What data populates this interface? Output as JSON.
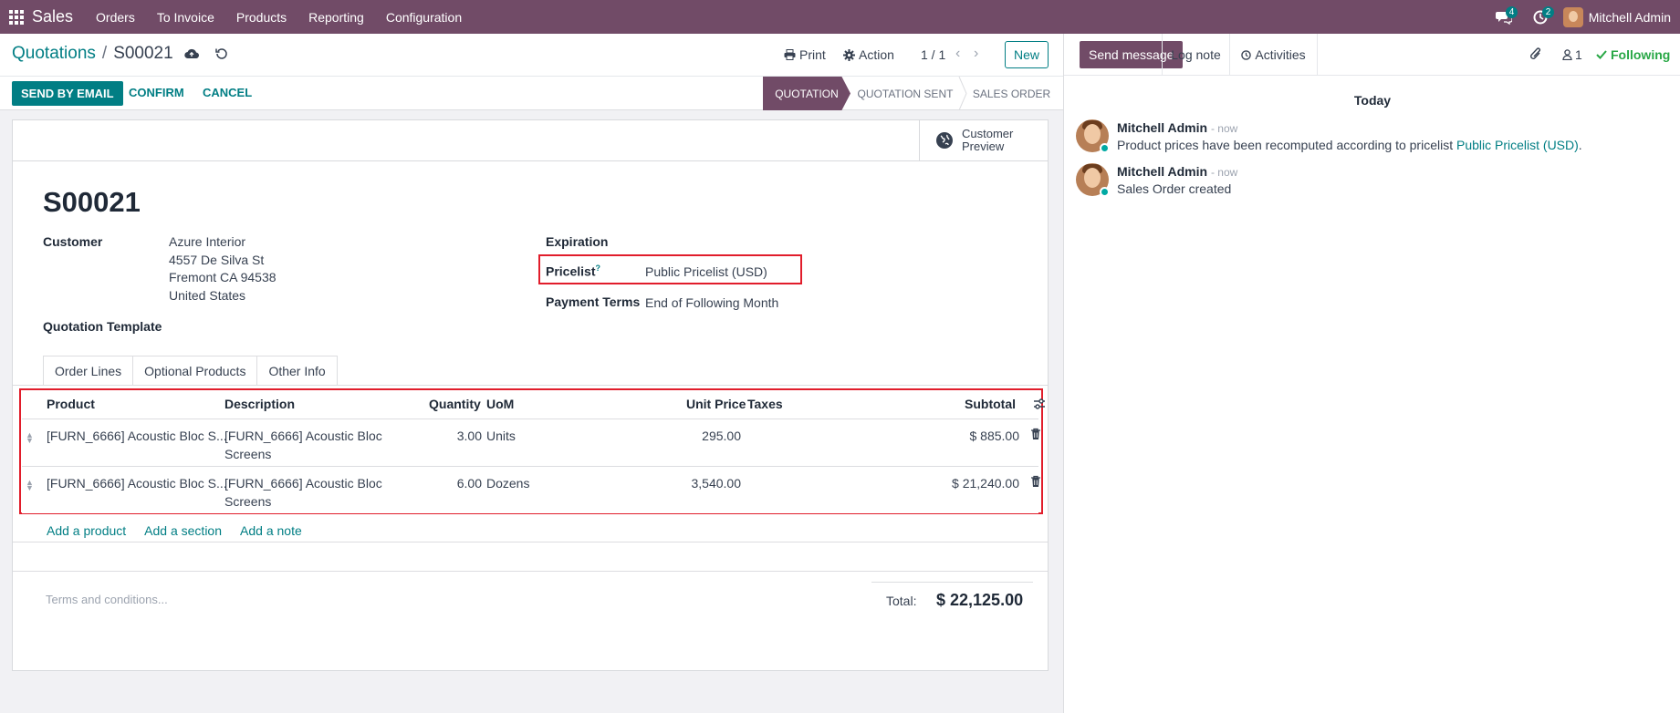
{
  "nav": {
    "app_name": "Sales",
    "menu": [
      "Orders",
      "To Invoice",
      "Products",
      "Reporting",
      "Configuration"
    ],
    "messages_badge": "4",
    "activities_badge": "2",
    "user_name": "Mitchell Admin"
  },
  "control": {
    "breadcrumb_parent": "Quotations",
    "breadcrumb_sep": "/",
    "record_name": "S00021",
    "print_label": "Print",
    "action_label": "Action",
    "pager": "1 / 1",
    "new_label": "New"
  },
  "statusbar": {
    "send_email_label": "SEND BY EMAIL",
    "confirm_label": "CONFIRM",
    "cancel_label": "CANCEL",
    "stages": [
      "QUOTATION",
      "QUOTATION SENT",
      "SALES ORDER"
    ],
    "active_stage": "QUOTATION"
  },
  "form": {
    "preview_line1": "Customer",
    "preview_line2": "Preview",
    "title": "S00021",
    "customer_label": "Customer",
    "customer_name": "Azure Interior",
    "customer_addr1": "4557 De Silva St",
    "customer_addr2": "Fremont CA 94538",
    "customer_addr3": "United States",
    "template_label": "Quotation Template",
    "expiration_label": "Expiration",
    "pricelist_label": "Pricelist",
    "pricelist_help": "?",
    "pricelist_value": "Public Pricelist (USD)",
    "payment_terms_label": "Payment Terms",
    "payment_terms_value": "End of Following Month"
  },
  "tabs": [
    "Order Lines",
    "Optional Products",
    "Other Info"
  ],
  "order_lines": {
    "headers": {
      "product": "Product",
      "description": "Description",
      "quantity": "Quantity",
      "uom": "UoM",
      "unit_price": "Unit Price",
      "taxes": "Taxes",
      "subtotal": "Subtotal"
    },
    "rows": [
      {
        "product": "[FURN_6666] Acoustic Bloc S...",
        "description_1": "[FURN_6666] Acoustic Bloc",
        "description_2": "Screens",
        "quantity": "3.00",
        "uom": "Units",
        "unit_price": "295.00",
        "subtotal": "$ 885.00"
      },
      {
        "product": "[FURN_6666] Acoustic Bloc S...",
        "description_1": "[FURN_6666] Acoustic Bloc",
        "description_2": "Screens",
        "quantity": "6.00",
        "uom": "Dozens",
        "unit_price": "3,540.00",
        "subtotal": "$ 21,240.00"
      }
    ],
    "add_product": "Add a product",
    "add_section": "Add a section",
    "add_note": "Add a note"
  },
  "footer": {
    "terms_placeholder": "Terms and conditions...",
    "total_label": "Total:",
    "total_value": "$ 22,125.00"
  },
  "chatter": {
    "send_message": "Send message",
    "log_note": "Log note",
    "activities": "Activities",
    "followers_count": "1",
    "following": "Following",
    "date_separator": "Today",
    "messages": [
      {
        "author": "Mitchell Admin",
        "time": "- now",
        "text": "Product prices have been recomputed according to pricelist ",
        "link": "Public Pricelist (USD)",
        "suffix": "."
      },
      {
        "author": "Mitchell Admin",
        "time": "- now",
        "text": "Sales Order created"
      }
    ]
  },
  "colors": {
    "brand": "#714b67",
    "accent": "#017e84",
    "highlight_box": "#e11d2b",
    "following": "#28a745"
  }
}
